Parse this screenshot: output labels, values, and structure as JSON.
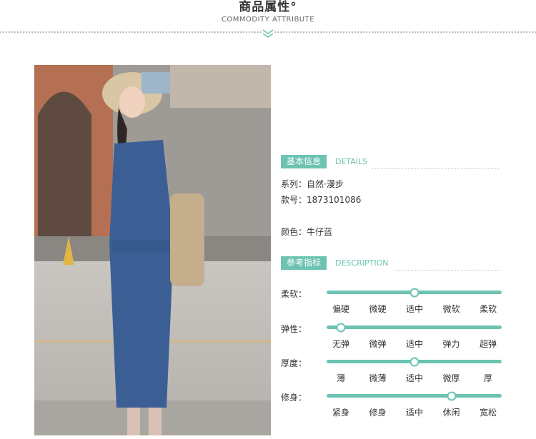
{
  "header": {
    "title": "商品属性°",
    "subtitle": "COMMODITY ATTRIBUTE"
  },
  "colors": {
    "accent": "#6cc3b2",
    "text": "#333333",
    "denim": "#3b5f95"
  },
  "photo": {
    "subject": "model wearing denim pinafore dress"
  },
  "basic_info": {
    "tag": "基本信息",
    "tag_en": "DETAILS",
    "rows": [
      {
        "text": "系列：自然·漫步"
      },
      {
        "text": "款号：1873101086"
      },
      {
        "text": "颜色：牛仔蓝"
      }
    ]
  },
  "reference": {
    "tag": "参考指标",
    "tag_en": "DESCRIPTION",
    "scales": [
      {
        "label": "柔软：",
        "options": [
          "偏硬",
          "微硬",
          "适中",
          "微软",
          "柔软"
        ],
        "selected_index": 2
      },
      {
        "label": "弹性：",
        "options": [
          "无弹",
          "微弹",
          "适中",
          "弹力",
          "超弹"
        ],
        "selected_index": 0
      },
      {
        "label": "厚度：",
        "options": [
          "薄",
          "微薄",
          "适中",
          "微厚",
          "厚"
        ],
        "selected_index": 2
      },
      {
        "label": "修身：",
        "options": [
          "紧身",
          "修身",
          "适中",
          "休闲",
          "宽松"
        ],
        "selected_index": 3
      }
    ]
  }
}
